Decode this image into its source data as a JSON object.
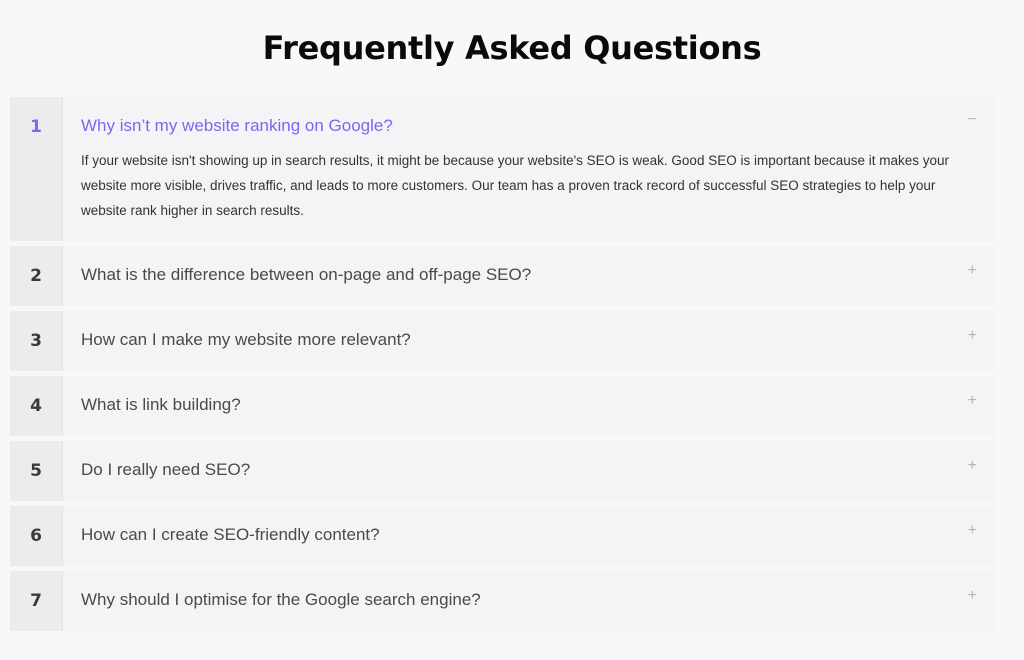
{
  "page": {
    "title": "Frequently Asked Questions"
  },
  "colors": {
    "accent": "#7b68ee",
    "text": "#4a4a4a",
    "background": "#f7f8fa"
  },
  "faq": [
    {
      "number": "1",
      "question": "Why isn’t my website ranking on Google?",
      "answer": "If your website isn't showing up in search results, it might be because your website's SEO is weak. Good SEO is important because it makes your website more visible, drives traffic, and leads to more customers. Our team has a proven track record of successful SEO strategies to help your website rank higher in search results.",
      "expanded": true,
      "toggle": "−"
    },
    {
      "number": "2",
      "question": "What is the difference between on-page and off-page SEO?",
      "expanded": false,
      "toggle": "+"
    },
    {
      "number": "3",
      "question": "How can I make my website more relevant?",
      "expanded": false,
      "toggle": "+"
    },
    {
      "number": "4",
      "question": "What is link building?",
      "expanded": false,
      "toggle": "+"
    },
    {
      "number": "5",
      "question": "Do I really need SEO?",
      "expanded": false,
      "toggle": "+"
    },
    {
      "number": "6",
      "question": "How can I create SEO-friendly content?",
      "expanded": false,
      "toggle": "+"
    },
    {
      "number": "7",
      "question": "Why should I optimise for the Google search engine?",
      "expanded": false,
      "toggle": "+"
    }
  ]
}
